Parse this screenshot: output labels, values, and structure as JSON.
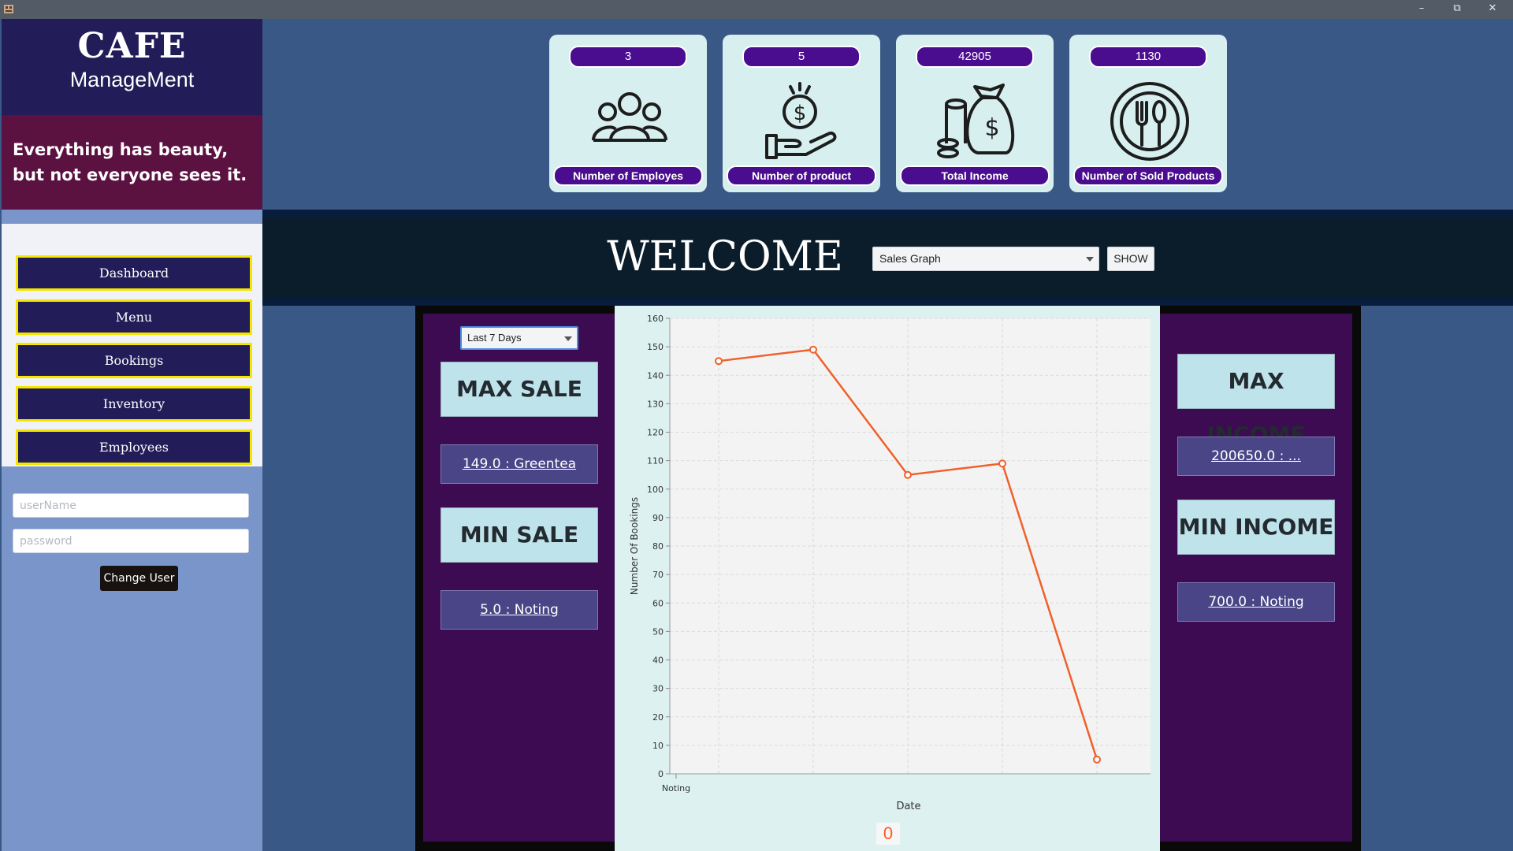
{
  "window": {
    "icons": {
      "app": "app-icon",
      "minimize": "minimize-icon",
      "restore": "restore-icon",
      "close": "close-icon"
    }
  },
  "sidebar": {
    "brand_title": "CAFE",
    "brand_subtitle": "ManageMent",
    "quote": "Everything has beauty, but not everyone sees it.",
    "nav": [
      "Dashboard",
      "Menu",
      "Bookings",
      "Inventory",
      "Employees"
    ],
    "username_placeholder": "userName",
    "password_placeholder": "password",
    "change_user_label": "Change User"
  },
  "stats": [
    {
      "value": "3",
      "label": "Number of Employes",
      "icon": "people-icon"
    },
    {
      "value": "5",
      "label": "Number of product",
      "icon": "money-hand-icon"
    },
    {
      "value": "42905",
      "label": "Total Income",
      "icon": "money-bag-icon"
    },
    {
      "value": "1130",
      "label": "Number of Sold Products",
      "icon": "plate-cutlery-icon"
    }
  ],
  "welcome": {
    "title": "WELCOME",
    "graph_select": "Sales Graph",
    "show_label": "SHOW"
  },
  "analytics": {
    "period": "Last 7 Days",
    "max_sale_label": "MAX SALE",
    "max_sale_value": "149.0 : Greentea",
    "min_sale_label": "MIN SALE",
    "min_sale_value": "5.0 : Noting",
    "max_income_label": "MAX INCOME",
    "max_income_value": "200650.0 : ...",
    "min_income_label": "MIN INCOME",
    "min_income_value": "700.0 : Noting",
    "counter": "0"
  },
  "colors": {
    "accent": "#4b0d8f",
    "nav_border": "#f5e600",
    "line": "#f0602a"
  },
  "chart_data": {
    "type": "line",
    "xlabel": "Date",
    "ylabel": "Number Of Bookings",
    "ylim": [
      0,
      160
    ],
    "yticks": [
      0,
      10,
      20,
      30,
      40,
      50,
      60,
      70,
      80,
      90,
      100,
      110,
      120,
      130,
      140,
      150,
      160
    ],
    "x_tick_labels": [
      "Noting"
    ],
    "grid": true,
    "series": [
      {
        "values": [
          145,
          149,
          105,
          109,
          5
        ]
      }
    ]
  }
}
